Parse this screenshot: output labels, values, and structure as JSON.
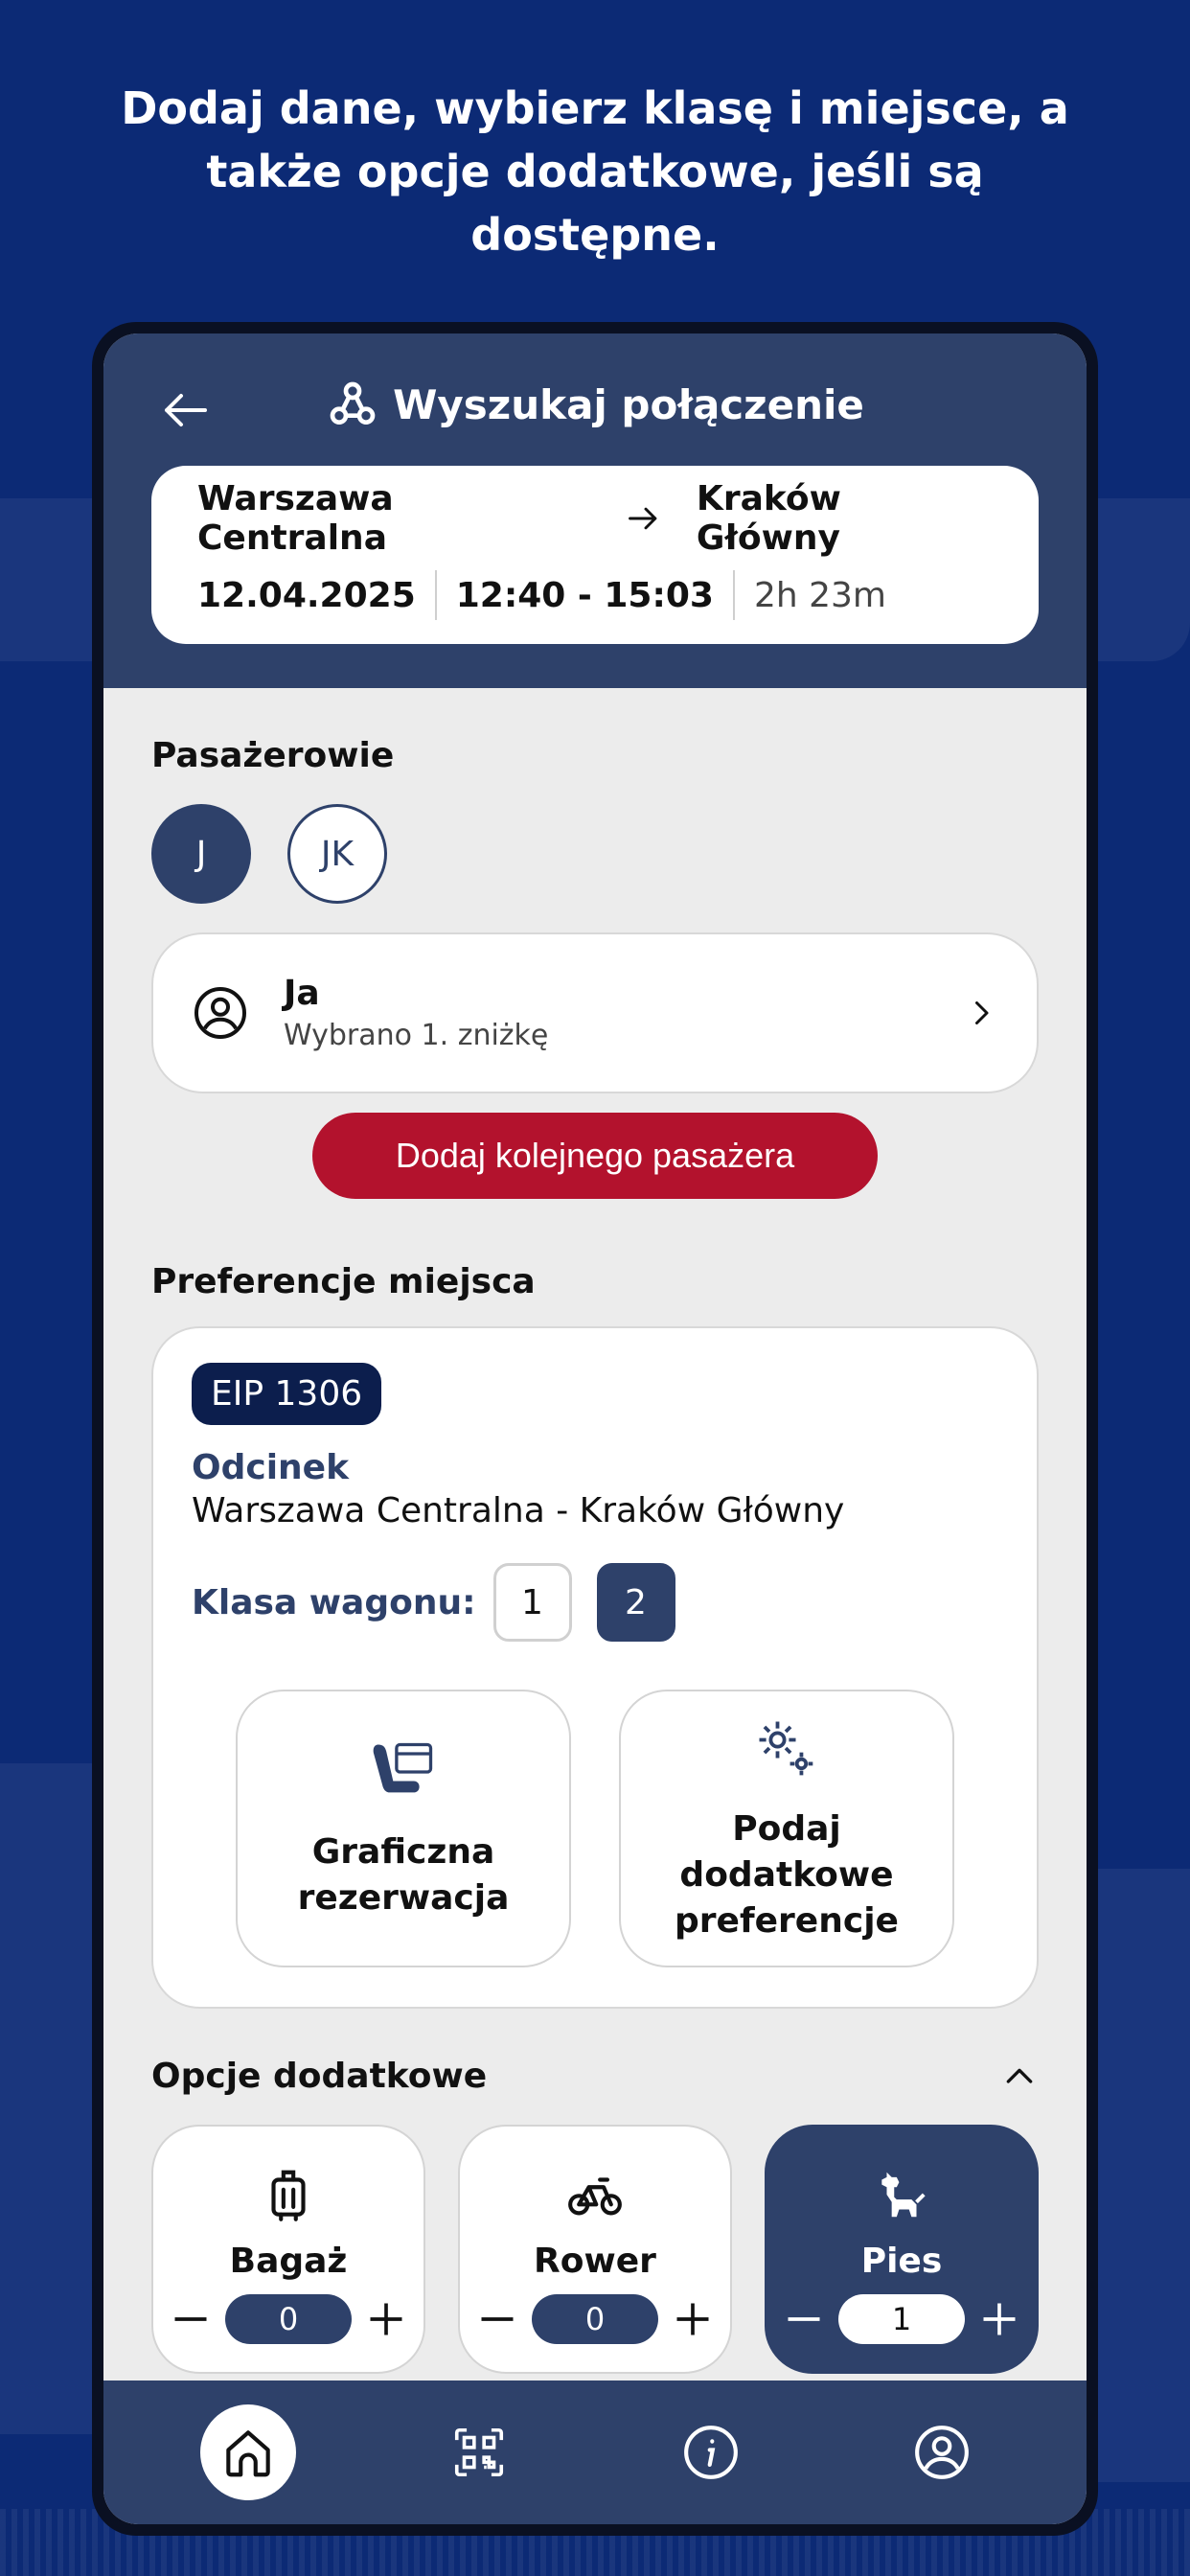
{
  "headline": "Dodaj dane, wybierz klasę i miejsce, a także opcje dodatkowe, jeśli są dostępne.",
  "header": {
    "title": "Wyszukaj połączenie",
    "back_icon": "arrow-left-icon",
    "title_icon": "connection-nodes-icon"
  },
  "route": {
    "from": "Warszawa Centralna",
    "to": "Kraków Główny",
    "date": "12.04.2025",
    "time": "12:40 - 15:03",
    "duration": "2h 23m"
  },
  "passengers": {
    "title": "Pasażerowie",
    "avatars": [
      {
        "initials": "J",
        "active": true
      },
      {
        "initials": "JK",
        "active": false
      }
    ],
    "selected": {
      "name": "Ja",
      "subtitle": "Wybrano 1. zniżkę"
    },
    "add_button": "Dodaj kolejnego pasażera"
  },
  "seat_preferences": {
    "title": "Preferencje miejsca",
    "train": "EIP 1306",
    "segment_label": "Odcinek",
    "segment_value": "Warszawa Centralna - Kraków Główny",
    "class_label": "Klasa wagonu:",
    "classes": [
      "1",
      "2"
    ],
    "selected_class": "2",
    "actions": [
      {
        "label": "Graficzna rezerwacja",
        "icon": "seat-map-icon"
      },
      {
        "label": "Podaj dodatkowe preferencje",
        "icon": "gears-icon"
      }
    ]
  },
  "extras": {
    "title": "Opcje dodatkowe",
    "items": [
      {
        "label": "Bagaż",
        "icon": "luggage-icon",
        "count": "0",
        "active": false
      },
      {
        "label": "Rower",
        "icon": "bicycle-icon",
        "count": "0",
        "active": false
      },
      {
        "label": "Pies",
        "icon": "dog-icon",
        "count": "1",
        "active": true
      }
    ]
  },
  "nav": {
    "items": [
      "home-icon",
      "qr-code-icon",
      "info-icon",
      "profile-icon"
    ],
    "active": "home-icon"
  },
  "colors": {
    "background": "#0c2a75",
    "primary": "#2e416a",
    "accent_red": "#b3122d",
    "badge": "#0c1e4d"
  }
}
